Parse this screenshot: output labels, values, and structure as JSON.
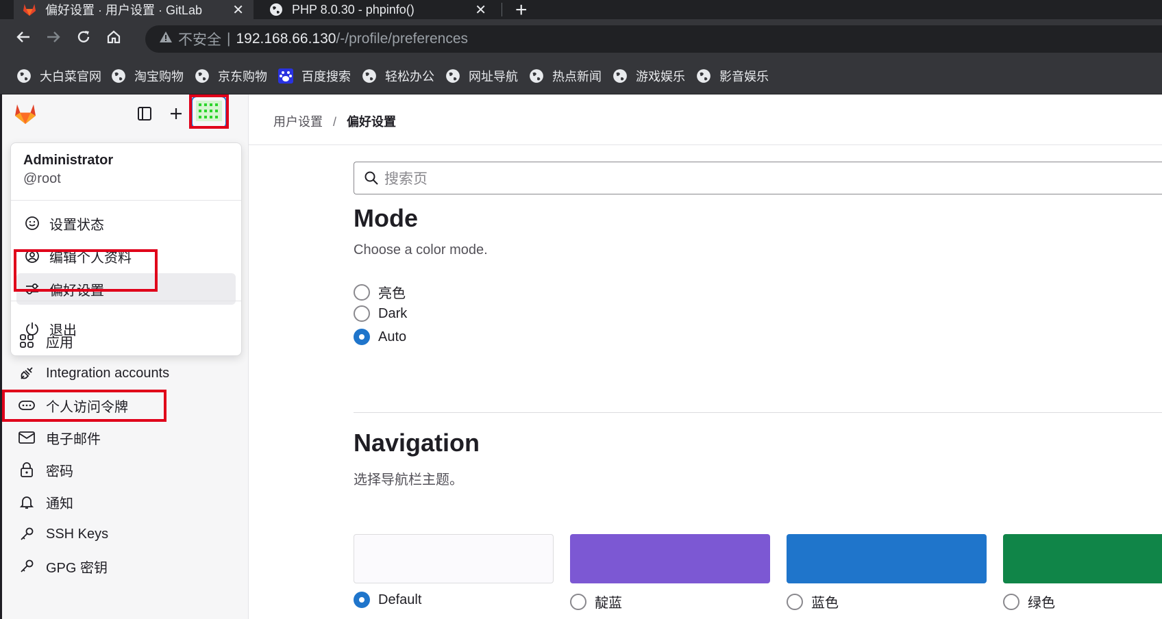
{
  "browser": {
    "tabs": [
      {
        "title": "偏好设置 · 用户设置 · GitLab",
        "close": "✕",
        "active": true,
        "icon": "gitlab-icon"
      },
      {
        "title": "PHP 8.0.30 - phpinfo()",
        "close": "✕",
        "active": false,
        "icon": "globe-icon"
      }
    ],
    "new_tab": "+",
    "address": {
      "insecure_label": "不安全",
      "divider": "|",
      "host": "192.168.66.130",
      "path": "/-/profile/preferences"
    },
    "bookmarks": [
      {
        "label": "大白菜官网",
        "icon": "globe-icon"
      },
      {
        "label": "淘宝购物",
        "icon": "globe-icon"
      },
      {
        "label": "京东购物",
        "icon": "globe-icon"
      },
      {
        "label": "百度搜索",
        "icon": "baidu-icon"
      },
      {
        "label": "轻松办公",
        "icon": "globe-icon"
      },
      {
        "label": "网址导航",
        "icon": "globe-icon"
      },
      {
        "label": "热点新闻",
        "icon": "globe-icon"
      },
      {
        "label": "游戏娱乐",
        "icon": "globe-icon"
      },
      {
        "label": "影音娱乐",
        "icon": "globe-icon"
      }
    ]
  },
  "user_menu": {
    "name": "Administrator",
    "handle": "@root",
    "items": [
      {
        "label": "设置状态",
        "icon": "smile-icon"
      },
      {
        "label": "编辑个人资料",
        "icon": "user-icon"
      },
      {
        "label": "偏好设置",
        "icon": "preferences-icon",
        "selected": true
      },
      {
        "label": "退出",
        "icon": "power-icon"
      }
    ]
  },
  "sidebar": {
    "items": [
      {
        "label": "应用",
        "icon": "applications-icon"
      },
      {
        "label": "Integration accounts",
        "icon": "plug-icon"
      },
      {
        "label": "个人访问令牌",
        "icon": "token-icon"
      },
      {
        "label": "电子邮件",
        "icon": "mail-icon"
      },
      {
        "label": "密码",
        "icon": "lock-icon"
      },
      {
        "label": "通知",
        "icon": "bell-icon"
      },
      {
        "label": "SSH Keys",
        "icon": "key-icon"
      },
      {
        "label": "GPG 密钥",
        "icon": "key-icon"
      }
    ]
  },
  "breadcrumb": {
    "parent": "用户设置",
    "separator": "/",
    "current": "偏好设置"
  },
  "search": {
    "placeholder": "搜索页"
  },
  "mode": {
    "title": "Mode",
    "description": "Choose a color mode.",
    "options": [
      {
        "label": "亮色",
        "checked": false
      },
      {
        "label": "Dark",
        "checked": false
      },
      {
        "label": "Auto",
        "checked": true
      }
    ]
  },
  "navigation": {
    "title": "Navigation",
    "description": "选择导航栏主题。",
    "themes": [
      {
        "label": "Default",
        "color": "#fbfafd",
        "checked": true
      },
      {
        "label": "靛蓝",
        "color": "#7c58d3",
        "checked": false
      },
      {
        "label": "蓝色",
        "color": "#1f75cb",
        "checked": false
      },
      {
        "label": "绿色",
        "color": "#108548",
        "checked": false
      }
    ]
  },
  "colors": {
    "accent": "#1f75cb",
    "highlight_box": "#e0001a"
  }
}
